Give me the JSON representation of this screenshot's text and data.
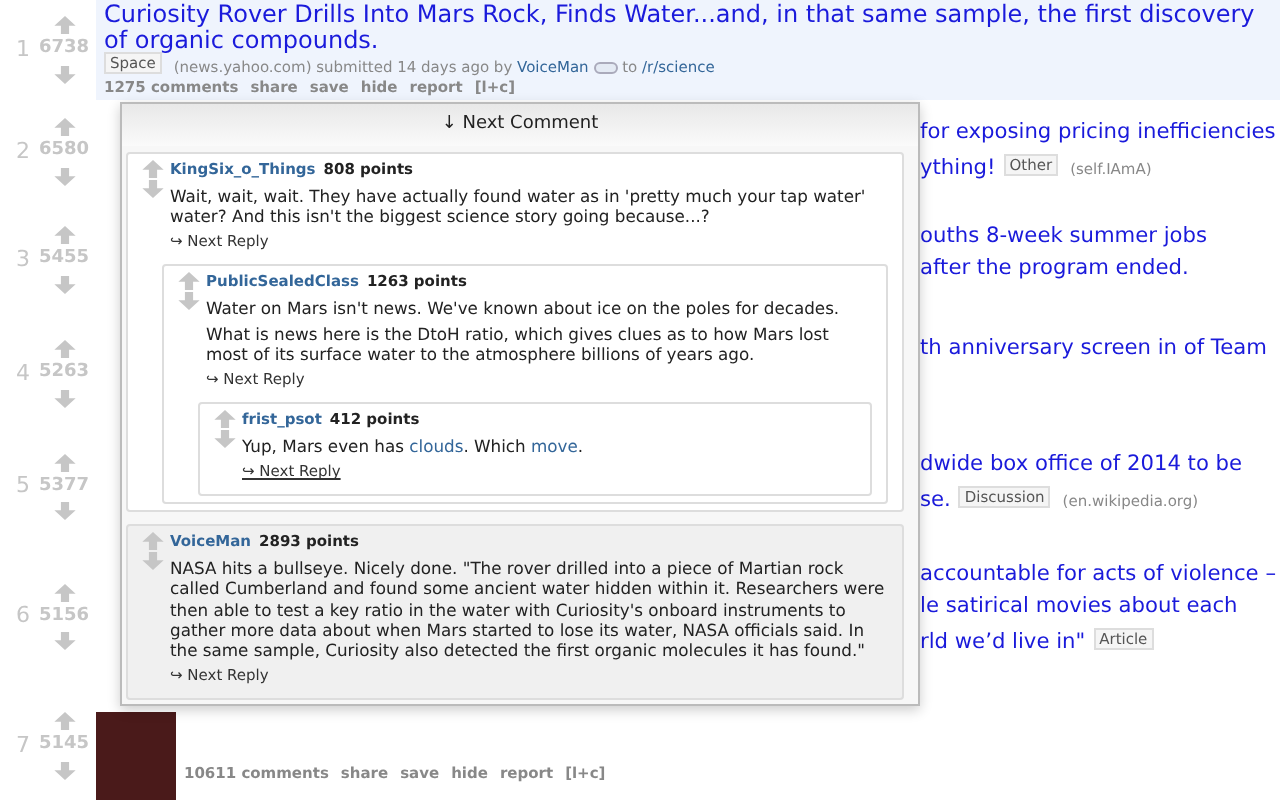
{
  "posts": [
    {
      "rank": "1",
      "score": "6738",
      "title": "Curiosity Rover Drills Into Mars Rock, Finds Water...and, in that same sample, the first discovery of organic compounds.",
      "flair": "Space",
      "domain": "(news.yahoo.com)",
      "submitted": "submitted 14 days ago by",
      "author": "VoiceMan",
      "to": "to",
      "subreddit": "/r/science",
      "actions": [
        "1275 comments",
        "share",
        "save",
        "hide",
        "report",
        "[l+c]"
      ]
    },
    {
      "rank": "2",
      "score": "6580",
      "fragments": [
        {
          "text": "for exposing pricing inefficiencies"
        },
        {
          "text": "ything!",
          "flair": "Other",
          "domain": "(self.IAmA)"
        }
      ]
    },
    {
      "rank": "3",
      "score": "5455",
      "fragments": [
        {
          "text": "ouths 8-week summer jobs"
        },
        {
          "text": "after the program ended."
        }
      ]
    },
    {
      "rank": "4",
      "score": "5263",
      "fragments": [
        {
          "text": "th anniversary screen in of Team"
        }
      ]
    },
    {
      "rank": "5",
      "score": "5377",
      "fragments": [
        {
          "text": "dwide box office of 2014 to be"
        },
        {
          "text": "se.",
          "flair": "Discussion",
          "domain": "(en.wikipedia.org)"
        }
      ]
    },
    {
      "rank": "6",
      "score": "5156",
      "fragments": [
        {
          "text": "accountable for acts of violence –"
        },
        {
          "text": "le satirical movies about each"
        },
        {
          "text": "rld we’d live in\"",
          "flair": "Article"
        }
      ]
    },
    {
      "rank": "7",
      "score": "5145",
      "actions": [
        "10611 comments",
        "share",
        "save",
        "hide",
        "report",
        "[l+c]"
      ]
    }
  ],
  "popup": {
    "next_comment": "↓ Next Comment",
    "comments": [
      {
        "author": "KingSix_o_Things",
        "points": "808 points",
        "shaded": false,
        "hovered": false,
        "reply": "↪ Next Reply",
        "paragraphs": [
          [
            {
              "kind": "text",
              "text": "Wait, wait, wait. They have actually found water as in 'pretty much your tap water' water? And this isn't the biggest science story going because...?"
            }
          ]
        ],
        "children": [
          {
            "author": "PublicSealedClass",
            "points": "1263 points",
            "shaded": false,
            "hovered": false,
            "reply": "↪ Next Reply",
            "paragraphs": [
              [
                {
                  "kind": "text",
                  "text": "Water on Mars isn't news. We've known about ice on the poles for decades."
                }
              ],
              [
                {
                  "kind": "text",
                  "text": "What is news here is the DtoH ratio, which gives clues as to how Mars lost most of its surface water to the atmosphere billions of years ago."
                }
              ]
            ],
            "children": [
              {
                "author": "frist_psot",
                "points": "412 points",
                "shaded": false,
                "hovered": true,
                "reply": "↪ Next Reply",
                "paragraphs": [
                  [
                    {
                      "kind": "text",
                      "text": "Yup, Mars even has "
                    },
                    {
                      "kind": "link",
                      "text": "clouds"
                    },
                    {
                      "kind": "text",
                      "text": ". Which "
                    },
                    {
                      "kind": "link",
                      "text": "move"
                    },
                    {
                      "kind": "text",
                      "text": "."
                    }
                  ]
                ]
              }
            ]
          }
        ]
      },
      {
        "author": "VoiceMan",
        "points": "2893 points",
        "shaded": true,
        "hovered": false,
        "reply": "↪ Next Reply",
        "paragraphs": [
          [
            {
              "kind": "text",
              "text": "NASA hits a bullseye. Nicely done. \"The rover drilled into a piece of Martian rock called Cumberland and found some ancient water hidden within it. Researchers were then able to test a key ratio in the water with Curiosity's onboard instruments to gather more data about when Mars started to lose its water, NASA officials said. In the same sample, Curiosity also detected the first organic molecules it has found.\""
            }
          ]
        ]
      }
    ]
  }
}
